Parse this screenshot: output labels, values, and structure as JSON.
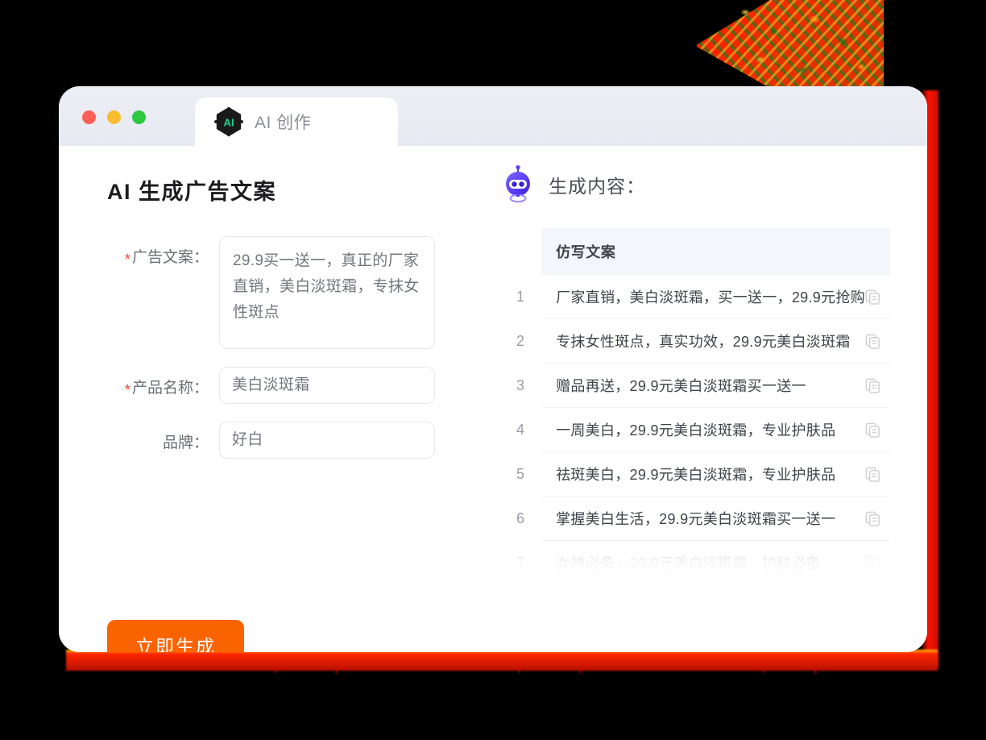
{
  "window": {
    "traffic_lights": [
      {
        "name": "close",
        "color": "#ff5f57"
      },
      {
        "name": "minimize",
        "color": "#f7bd2e"
      },
      {
        "name": "zoom",
        "color": "#2bc840"
      }
    ],
    "tab": {
      "icon": "ai-hexagon-logo",
      "logo_text": "AI",
      "label": "AI 创作"
    }
  },
  "left": {
    "title": "AI 生成广告文案",
    "fields": [
      {
        "label": "广告文案：",
        "required": true,
        "type": "textarea",
        "value": "29.9买一送一，真正的厂家直销，美白淡斑霜，专抹女性斑点"
      },
      {
        "label": "产品名称：",
        "required": true,
        "type": "input",
        "value": "美白淡斑霜"
      },
      {
        "label": "品牌：",
        "required": false,
        "type": "input",
        "value": "好白"
      }
    ],
    "submit_label": "立即生成"
  },
  "right": {
    "icon": "robot-icon",
    "title": "生成内容：",
    "table": {
      "column_header": "仿写文案",
      "copy_icon": "copy-icon",
      "rows": [
        {
          "index": "1",
          "text": "厂家直销，美白淡斑霜，买一送一，29.9元抢购",
          "faded": false
        },
        {
          "index": "2",
          "text": "专抹女性斑点，真实功效，29.9元美白淡斑霜",
          "faded": false
        },
        {
          "index": "3",
          "text": "赠品再送，29.9元美白淡斑霜买一送一",
          "faded": false
        },
        {
          "index": "4",
          "text": "一周美白，29.9元美白淡斑霜，专业护肤品",
          "faded": false
        },
        {
          "index": "5",
          "text": "祛斑美白，29.9元美白淡斑霜，专业护肤品",
          "faded": false
        },
        {
          "index": "6",
          "text": "掌握美白生活，29.9元美白淡斑霜买一送一",
          "faded": false
        },
        {
          "index": "7",
          "text": "女神必备，29.9元美白淡斑霜，护肤必备",
          "faded": true
        }
      ]
    }
  },
  "colors": {
    "accent_orange": "#fa6400",
    "required_star": "#ff4d3d",
    "logo_green": "#1fd18a",
    "robot_purple": "#5b3df5",
    "table_header_bg": "#f3f6fa",
    "decoration_red": "#ff1a00"
  }
}
